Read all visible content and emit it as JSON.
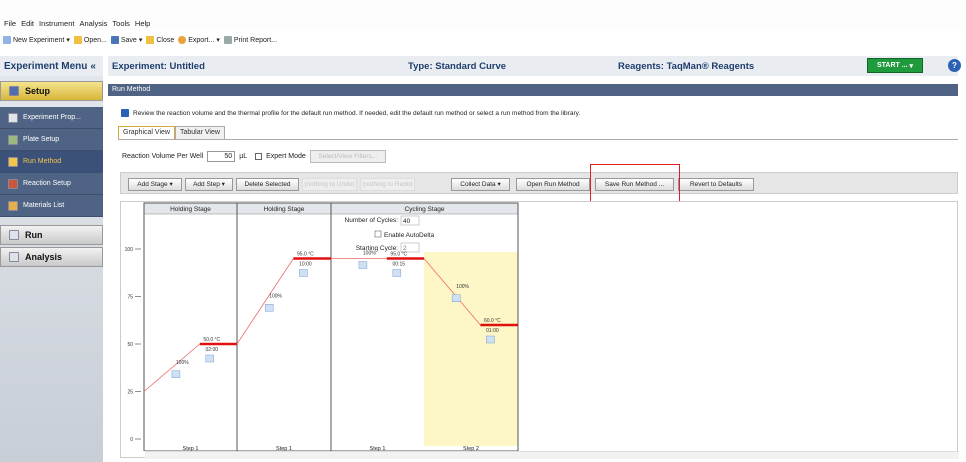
{
  "menubar": {
    "items": [
      "File",
      "Edit",
      "Instrument",
      "Analysis",
      "Tools",
      "Help"
    ]
  },
  "toolbar": {
    "new_experiment": "New Experiment",
    "open": "Open...",
    "save": "Save",
    "close": "Close",
    "export": "Export...",
    "print_report": "Print Report..."
  },
  "sidebar": {
    "title": "Experiment Menu",
    "collapse_glyph": "«",
    "setup_label": "Setup",
    "items": [
      {
        "label": "Experiment Prop...",
        "active": false
      },
      {
        "label": "Plate Setup",
        "active": false
      },
      {
        "label": "Run Method",
        "active": true
      },
      {
        "label": "Reaction Setup",
        "active": false
      },
      {
        "label": "Materials List",
        "active": false
      }
    ],
    "run_label": "Run",
    "analysis_label": "Analysis"
  },
  "header": {
    "experiment": "Experiment:  Untitled",
    "type": "Type: Standard Curve",
    "reagents": "Reagents: TaqMan® Reagents",
    "start_button": "START ...",
    "help_glyph": "?"
  },
  "section": {
    "title": "Run Method",
    "info_text": "Review the reaction volume and the thermal profile for the default run method. If needed, edit the default run method or select a run method from the library."
  },
  "tabs": [
    {
      "label": "Graphical View",
      "active": true
    },
    {
      "label": "Tabular View",
      "active": false
    }
  ],
  "volume": {
    "label": "Reaction Volume Per Well",
    "value": "50",
    "unit": "µL",
    "expert_mode": "Expert Mode",
    "select_filters": "Select/View Filters..."
  },
  "actions": {
    "add_stage": "Add Stage",
    "add_step": "Add Step",
    "delete_selected": "Delete Selected",
    "undo": "(nothing to Undo)",
    "redo": "(nothing to Redo)",
    "collect_data": "Collect Data",
    "open_run_method": "Open Run Method",
    "save_run_method": "Save Run Method ...",
    "revert_defaults": "Revert to Defaults"
  },
  "chart_data": {
    "type": "line",
    "y_ticks": [
      0,
      25,
      50,
      75,
      100
    ],
    "stages": [
      {
        "name": "Holding Stage",
        "steps": [
          {
            "label": "Step 1",
            "temp": "50.0 °C",
            "time": "02:00",
            "ramp": "100%",
            "value": 50
          }
        ]
      },
      {
        "name": "Holding Stage",
        "steps": [
          {
            "label": "Step 1",
            "temp": "95.0 °C",
            "time": "10:00",
            "ramp": "100%",
            "value": 95
          }
        ]
      },
      {
        "name": "Cycling Stage",
        "cycles_label": "Number of Cycles:",
        "cycles": "40",
        "auto_delta": "Enable AutoDelta",
        "starting_cycle_label": "Starting Cycle:",
        "starting_cycle": "2",
        "steps": [
          {
            "label": "Step 1",
            "temp": "95.0 °C",
            "time": "00:15",
            "ramp": "100%",
            "value": 95
          },
          {
            "label": "Step 2",
            "temp": "60.0 °C",
            "time": "01:00",
            "ramp": "100%",
            "value": 60
          }
        ]
      }
    ],
    "start_value": 25,
    "colors": {
      "line": "#f06a6a",
      "plateau": "#e01010",
      "selected_bg": "#fdf7c7",
      "stage_border": "#555"
    }
  }
}
